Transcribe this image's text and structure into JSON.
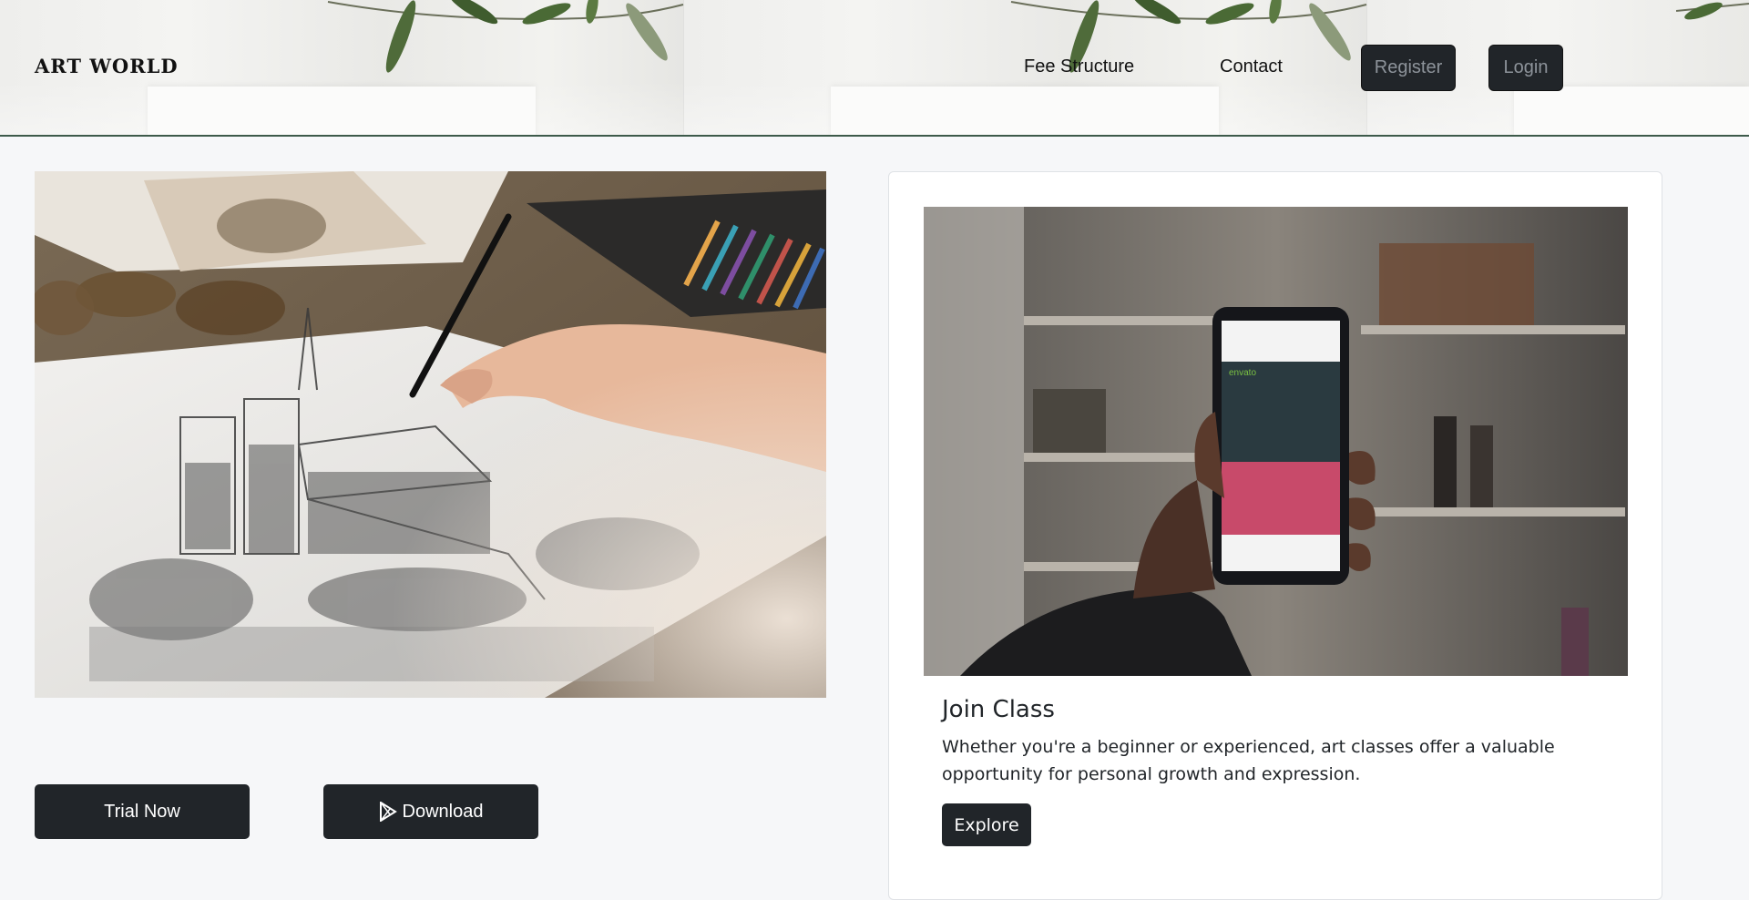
{
  "header": {
    "brand": "ART WORLD",
    "nav": {
      "fee_structure": "Fee Structure",
      "contact": "Contact",
      "register": "Register",
      "login": "Login"
    }
  },
  "hero": {
    "image_alt": "hand sketching a cathedral drawing",
    "trial_label": "Trial Now",
    "download_label": "Download",
    "download_icon": "play-store-icon"
  },
  "card": {
    "image_alt": "hand holding a smartphone showing envato tuts+",
    "title": "Join Class",
    "text": "Whether you're a beginner or experienced, art classes offer a valuable opportunity for personal growth and expression.",
    "button_label": "Explore"
  },
  "colors": {
    "dark_button": "#212529",
    "header_border": "#3d5a4a",
    "page_bg": "#f6f7f9"
  }
}
